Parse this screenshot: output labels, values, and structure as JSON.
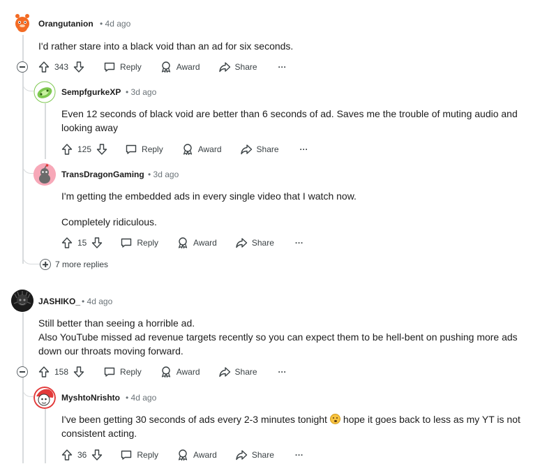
{
  "comments": [
    {
      "author": "Orangutanion",
      "time": "4d ago",
      "body": [
        "I'd rather stare into a black void than an ad for six seconds."
      ],
      "votes": "343",
      "reply": "Reply",
      "award": "Award",
      "share": "Share",
      "more": "···",
      "replies": [
        {
          "author": "SempfgurkeXP",
          "time": "3d ago",
          "body": [
            "Even 12 seconds of black void are better than 6 seconds of ad. Saves me the trouble of muting audio and looking away"
          ],
          "votes": "125",
          "reply": "Reply",
          "award": "Award",
          "share": "Share",
          "more": "···"
        },
        {
          "author": "TransDragonGaming",
          "time": "3d ago",
          "body": [
            "I'm getting the embedded ads in every single video that I watch now.",
            "Completely ridiculous."
          ],
          "votes": "15",
          "reply": "Reply",
          "award": "Award",
          "share": "Share",
          "more": "···"
        }
      ],
      "more_replies": "7 more replies"
    },
    {
      "author": "JASHIKO_",
      "time": "4d ago",
      "body": [
        "Still better than seeing a horrible ad.",
        "Also YouTube missed ad revenue targets recently so you can expect them to be hell-bent on pushing more ads down our throats moving forward."
      ],
      "votes": "158",
      "reply": "Reply",
      "award": "Award",
      "share": "Share",
      "more": "···",
      "replies": [
        {
          "author": "MyshtoNrishto",
          "time": "4d ago",
          "body_before_emoji": "I've been getting 30 seconds of ads every 2-3 minutes tonight",
          "body_after_emoji": "hope it goes back to less as my YT is not consistent acting.",
          "emoji": "grimacing-face-emoji",
          "votes": "36",
          "reply": "Reply",
          "award": "Award",
          "share": "Share",
          "more": "···"
        }
      ]
    }
  ],
  "separator": "•",
  "colors": {
    "text": "#1c1c1c",
    "meta": "#6b7378",
    "thread_line": "#d8dbdd",
    "orange": "#ff4500"
  }
}
